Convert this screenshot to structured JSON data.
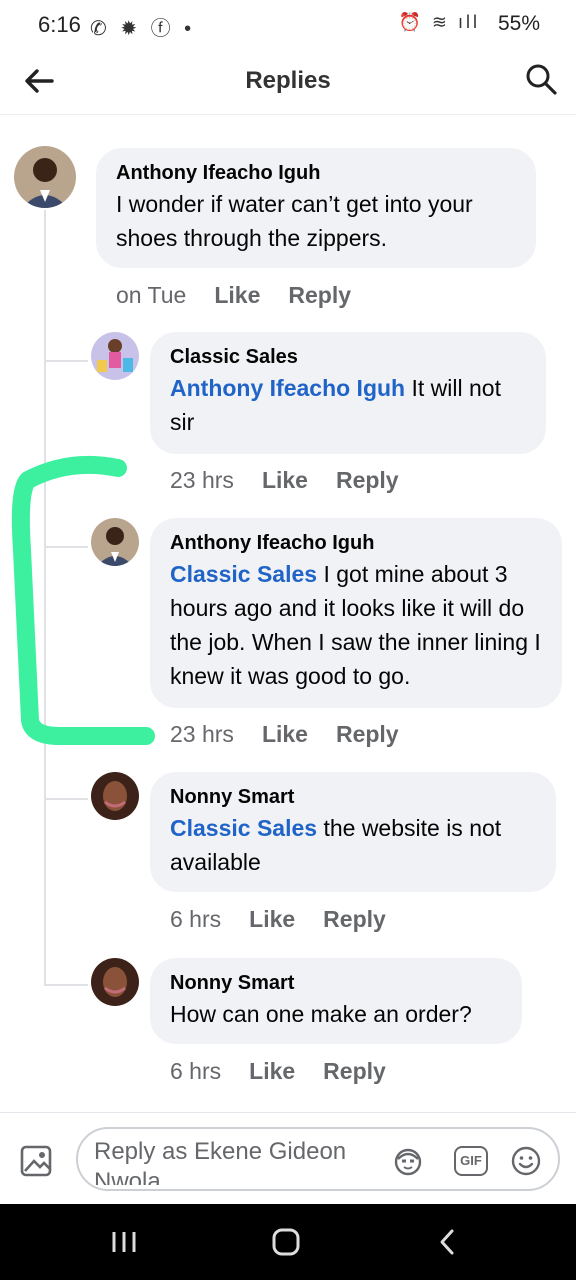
{
  "status": {
    "time": "6:16",
    "left_icons": "✆ ✹ ⓕ •",
    "right_icons": "⏰ ≋ ıll",
    "battery": "55%"
  },
  "header": {
    "title": "Replies"
  },
  "comments": [
    {
      "author": "Anthony Ifeacho Iguh",
      "mention": "",
      "text": "I wonder if water can’t get into your shoes through the zippers.",
      "time": "on Tue",
      "like": "Like",
      "reply": "Reply"
    },
    {
      "author": "Classic Sales",
      "mention": "Anthony Ifeacho Iguh",
      "text": " It will not sir",
      "time": "23 hrs",
      "like": "Like",
      "reply": "Reply"
    },
    {
      "author": "Anthony Ifeacho Iguh",
      "mention": "Classic Sales",
      "text": "  I got mine about 3 hours ago and it looks like it will do the job. When I saw the inner lining I knew it was good to go.",
      "time": "23 hrs",
      "like": "Like",
      "reply": "Reply"
    },
    {
      "author": "Nonny Smart",
      "mention": "Classic Sales",
      "text": "  the website is not available",
      "time": "6 hrs",
      "like": "Like",
      "reply": "Reply"
    },
    {
      "author": "Nonny Smart",
      "mention": "",
      "text": "How can one make an order?",
      "time": "6 hrs",
      "like": "Like",
      "reply": "Reply"
    }
  ],
  "composer": {
    "placeholder": "Reply as Ekene Gideon Nwola",
    "gif_label": "GIF"
  },
  "colors": {
    "accent": "#2064c8",
    "highlight": "#3cf0a0",
    "bubble": "#f0f2f5"
  }
}
